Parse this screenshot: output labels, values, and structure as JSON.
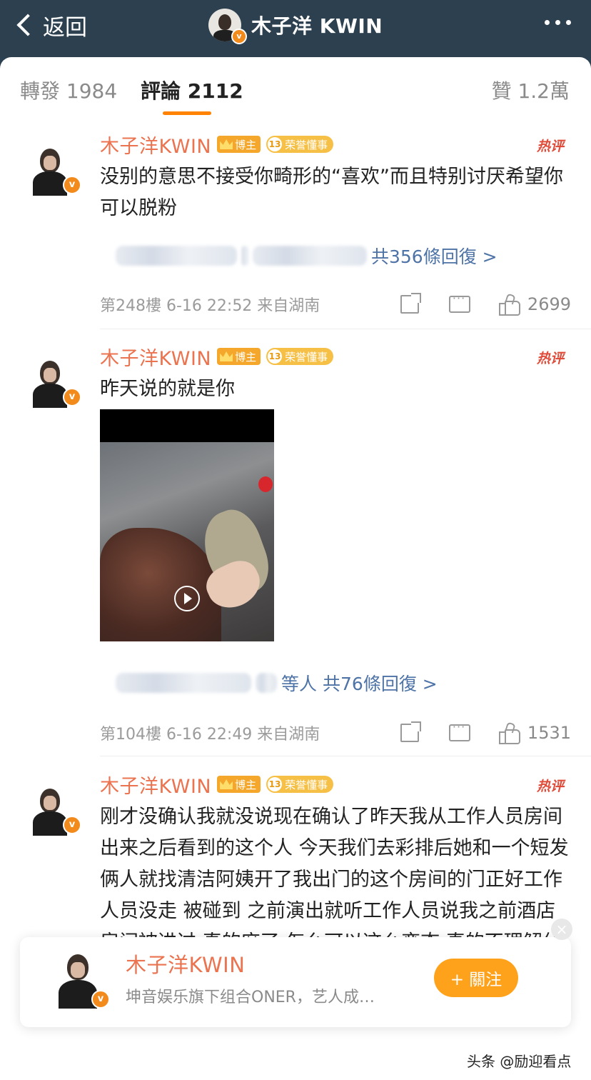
{
  "header": {
    "back_label": "返回",
    "title": "木子洋 KWIN",
    "verified_mark": "v"
  },
  "tabs": {
    "repost": "轉發 1984",
    "comments": "評論 2112",
    "likes": "贊 1.2萬"
  },
  "comments": [
    {
      "user": "木子洋KWIN",
      "badge_blogger": "博主",
      "badge_level": "13",
      "badge_honor": "荣誉懂事",
      "hot": "热评",
      "text": "没别的意思不接受你畸形的“喜欢”而且特别讨厌希望你可以脱粉",
      "reply_summary": "共356條回復 >",
      "floor": "第248樓 6-16 22:52 来自湖南",
      "likes": "2699",
      "verified_mark": "v"
    },
    {
      "user": "木子洋KWIN",
      "badge_blogger": "博主",
      "badge_level": "13",
      "badge_honor": "荣誉懂事",
      "hot": "热评",
      "text": "昨天说的就是你",
      "reply_summary_visible": "等人",
      "reply_summary": "共76條回復 >",
      "floor": "第104樓 6-16 22:49 来自湖南",
      "likes": "1531",
      "verified_mark": "v"
    },
    {
      "user": "木子洋KWIN",
      "badge_blogger": "博主",
      "badge_level": "13",
      "badge_honor": "荣誉懂事",
      "hot": "热评",
      "text": "刚才没确认我就没说现在确认了昨天我从工作人员房间出来之后看到的这个人 今天我们去彩排后她和一个短发俩人就找清洁阿姨开了我出门的这个房间的门正好工作人员没走 被碰到 之前演出就听工作人员说我之前酒店房间被进过 真的麻了 怎么可以这么变态 真的不理解什么样畸形心理🤮",
      "verified_mark": "v"
    }
  ],
  "profile_card": {
    "name": "木子洋KWIN",
    "description": "坤音娱乐旗下组合ONER，艺人成…",
    "follow_label": "+ 關注",
    "close": "×",
    "verified_mark": "v"
  },
  "watermark": "头条 @励迎看点",
  "icons": [
    "back-chevron-icon",
    "more-icon",
    "share-icon",
    "comment-icon",
    "like-icon",
    "play-icon",
    "crown-icon"
  ],
  "colors": {
    "header_bg": "#2c4050",
    "username": "#eb7350",
    "accent": "#ff8200",
    "link": "#4e73a6",
    "hot": "#e04c3a",
    "follow": "#ffa21b"
  }
}
